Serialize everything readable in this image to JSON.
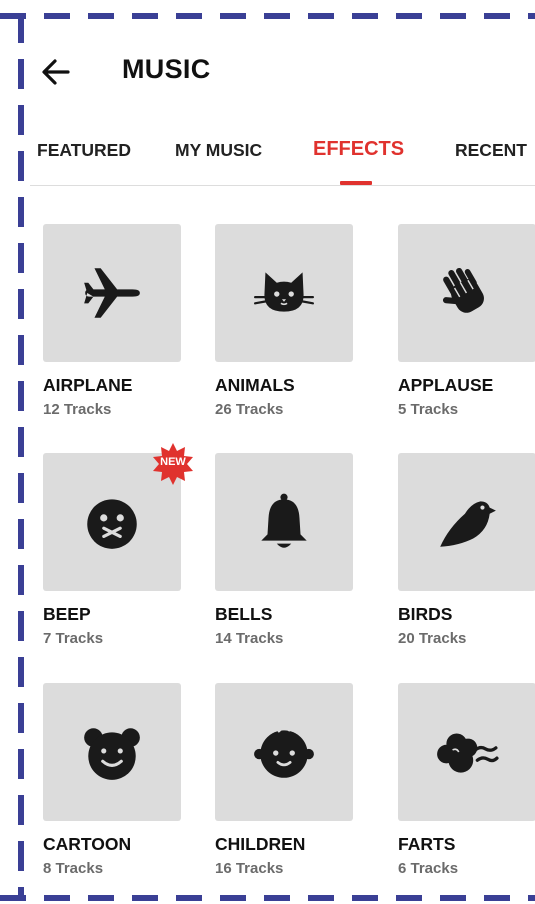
{
  "header": {
    "title": "MUSIC"
  },
  "tabs": [
    {
      "label": "FEATURED"
    },
    {
      "label": "MY MUSIC"
    },
    {
      "label": "EFFECTS",
      "active": true
    },
    {
      "label": "RECENT"
    }
  ],
  "colors": {
    "accent": "#e0322e",
    "tile_bg": "#dcdcdc",
    "frame": "#3a3f95"
  },
  "effects": [
    {
      "name": "AIRPLANE",
      "tracks": "12 Tracks",
      "icon": "airplane-icon"
    },
    {
      "name": "ANIMALS",
      "tracks": "26 Tracks",
      "icon": "cat-icon"
    },
    {
      "name": "APPLAUSE",
      "tracks": "5 Tracks",
      "icon": "clapping-hand-icon"
    },
    {
      "name": "BEEP",
      "tracks": "7 Tracks",
      "icon": "censored-face-icon",
      "badge": "NEW"
    },
    {
      "name": "BELLS",
      "tracks": "14 Tracks",
      "icon": "bell-icon"
    },
    {
      "name": "BIRDS",
      "tracks": "20 Tracks",
      "icon": "bird-icon"
    },
    {
      "name": "CARTOON",
      "tracks": "8 Tracks",
      "icon": "bear-icon"
    },
    {
      "name": "CHILDREN",
      "tracks": "16 Tracks",
      "icon": "baby-face-icon"
    },
    {
      "name": "FARTS",
      "tracks": "6 Tracks",
      "icon": "fart-cloud-icon"
    }
  ]
}
